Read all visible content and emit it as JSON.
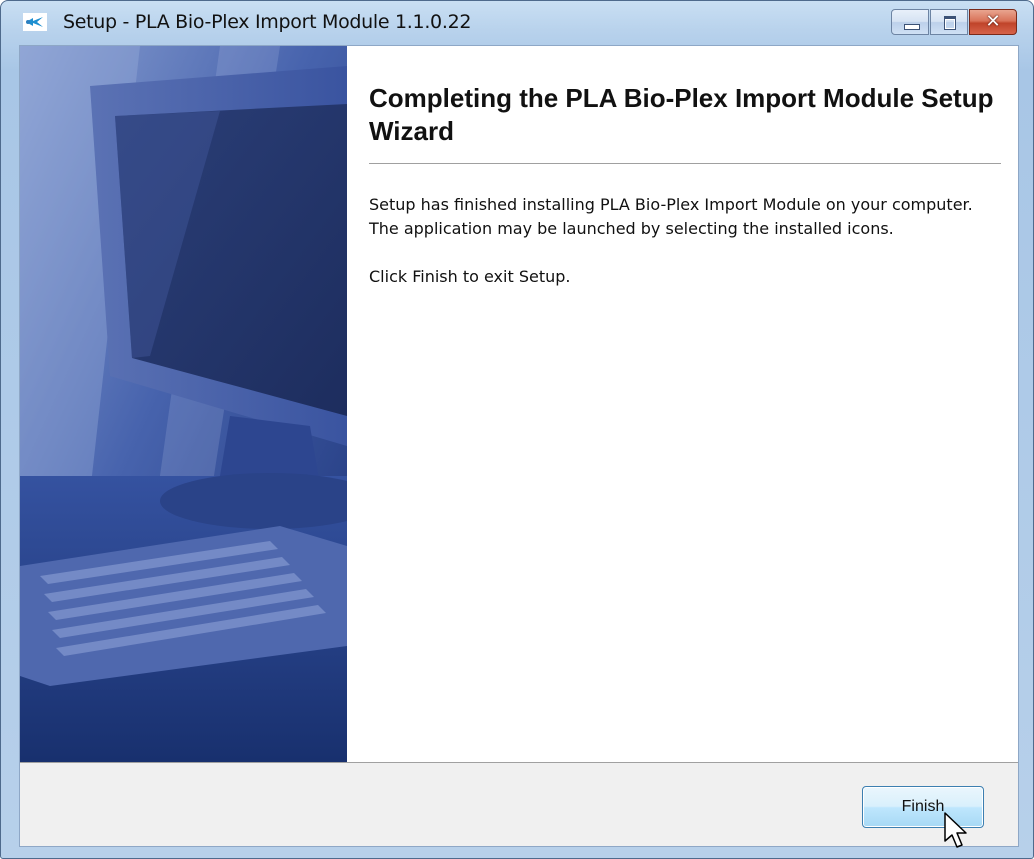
{
  "window": {
    "title": "Setup - PLA Bio-Plex Import Module 1.1.0.22",
    "icon": "setup-app-icon",
    "controls": {
      "minimize": "minimize-icon",
      "maximize": "maximize-icon",
      "close": "close-icon",
      "close_glyph": "✕"
    }
  },
  "wizard": {
    "heading": "Completing the PLA Bio-Plex Import Module Setup Wizard",
    "paragraph1": "Setup has finished installing PLA Bio-Plex Import Module on your computer. The application may be launched by selecting the installed icons.",
    "paragraph2": "Click Finish to exit Setup.",
    "side_image": "computer-monitor-keyboard-illustration"
  },
  "footer": {
    "finish_label": "Finish"
  },
  "colors": {
    "titlebar": "#b8d2ec",
    "side_image_blue": "#2a4594",
    "close_red": "#c0442a",
    "button_blue": "#bee6fd"
  }
}
